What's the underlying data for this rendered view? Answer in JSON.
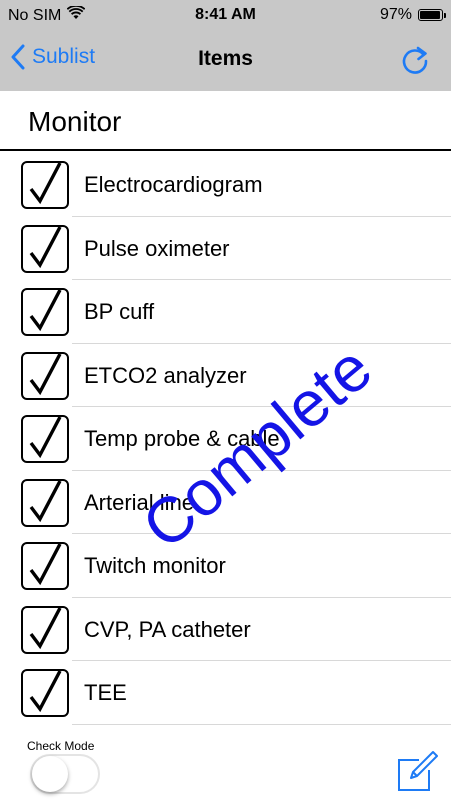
{
  "status_bar": {
    "carrier": "No SIM",
    "time": "8:41 AM",
    "battery_percent": "97%",
    "battery_level": 0.97
  },
  "nav": {
    "back_label": "Sublist",
    "title": "Items",
    "accent_color": "#1e7bf5"
  },
  "section": {
    "title": "Monitor"
  },
  "items": [
    {
      "label": "Electrocardiogram",
      "checked": true
    },
    {
      "label": "Pulse oximeter",
      "checked": true
    },
    {
      "label": "BP cuff",
      "checked": true
    },
    {
      "label": "ETCO2 analyzer",
      "checked": true
    },
    {
      "label": "Temp probe & cable",
      "checked": true
    },
    {
      "label": "Arterial line",
      "checked": true
    },
    {
      "label": "Twitch monitor",
      "checked": true
    },
    {
      "label": "CVP, PA catheter",
      "checked": true
    },
    {
      "label": "TEE",
      "checked": true
    }
  ],
  "overlay": {
    "text": "Complete",
    "color": "#1414e6"
  },
  "bottom": {
    "check_mode_label": "Check Mode",
    "check_mode_on": false
  },
  "icons": {
    "back": "chevron-left-icon",
    "refresh": "refresh-icon",
    "compose": "compose-icon",
    "wifi": "wifi-icon",
    "battery": "battery-icon",
    "checkmark": "checkmark-icon"
  }
}
